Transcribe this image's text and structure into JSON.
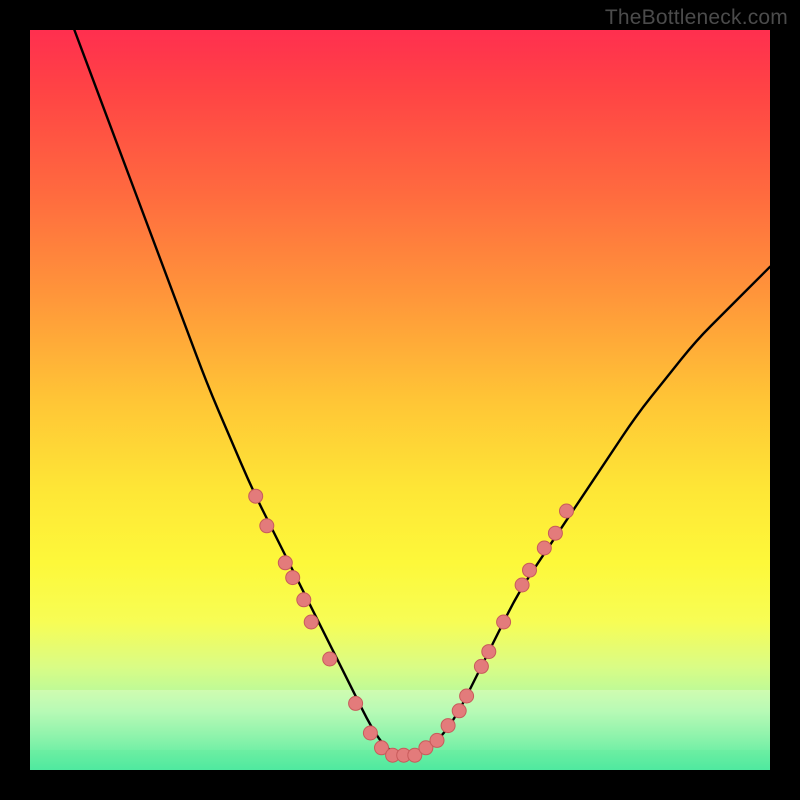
{
  "watermark": "TheBottleneck.com",
  "colors": {
    "frame": "#000000",
    "curve": "#000000",
    "marker_fill": "#e37b7b",
    "marker_stroke": "#c85b5b"
  },
  "chart_data": {
    "type": "line",
    "title": "",
    "xlabel": "",
    "ylabel": "",
    "xlim": [
      0,
      100
    ],
    "ylim": [
      0,
      100
    ],
    "series": [
      {
        "name": "bottleneck-curve",
        "x": [
          6,
          9,
          12,
          15,
          18,
          21,
          24,
          27,
          30,
          33,
          36,
          39,
          42,
          44,
          46,
          48,
          50,
          52,
          54,
          56,
          58,
          60,
          63,
          66,
          70,
          74,
          78,
          82,
          86,
          90,
          94,
          98,
          100
        ],
        "y": [
          100,
          92,
          84,
          76,
          68,
          60,
          52,
          45,
          38,
          32,
          26,
          20,
          14,
          10,
          6,
          3,
          2,
          2,
          3,
          5,
          8,
          12,
          18,
          24,
          30,
          36,
          42,
          48,
          53,
          58,
          62,
          66,
          68
        ]
      }
    ],
    "markers": {
      "name": "highlight-points",
      "shape": "circle",
      "radius_px": 7,
      "points": [
        {
          "x": 30.5,
          "y": 37
        },
        {
          "x": 32.0,
          "y": 33
        },
        {
          "x": 34.5,
          "y": 28
        },
        {
          "x": 35.5,
          "y": 26
        },
        {
          "x": 37.0,
          "y": 23
        },
        {
          "x": 38.0,
          "y": 20
        },
        {
          "x": 40.5,
          "y": 15
        },
        {
          "x": 44.0,
          "y": 9
        },
        {
          "x": 46.0,
          "y": 5
        },
        {
          "x": 47.5,
          "y": 3
        },
        {
          "x": 49.0,
          "y": 2
        },
        {
          "x": 50.5,
          "y": 2
        },
        {
          "x": 52.0,
          "y": 2
        },
        {
          "x": 53.5,
          "y": 3
        },
        {
          "x": 55.0,
          "y": 4
        },
        {
          "x": 56.5,
          "y": 6
        },
        {
          "x": 58.0,
          "y": 8
        },
        {
          "x": 59.0,
          "y": 10
        },
        {
          "x": 61.0,
          "y": 14
        },
        {
          "x": 62.0,
          "y": 16
        },
        {
          "x": 64.0,
          "y": 20
        },
        {
          "x": 66.5,
          "y": 25
        },
        {
          "x": 67.5,
          "y": 27
        },
        {
          "x": 69.5,
          "y": 30
        },
        {
          "x": 71.0,
          "y": 32
        },
        {
          "x": 72.5,
          "y": 35
        }
      ]
    }
  }
}
